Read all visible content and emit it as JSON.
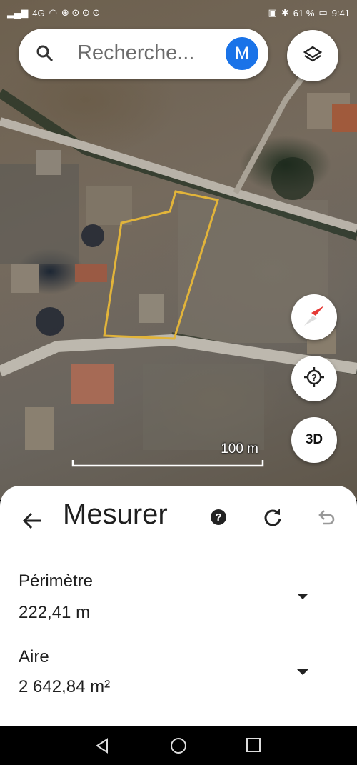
{
  "status_bar": {
    "time": "9:41",
    "battery": "61 %",
    "network": "4G"
  },
  "search": {
    "placeholder": "Recherche...",
    "avatar_initial": "M"
  },
  "map": {
    "scale_label": "100 m",
    "three_d_label": "3D"
  },
  "panel": {
    "title": "Mesurer",
    "metrics": [
      {
        "label": "Périmètre",
        "value": "222,41 m"
      },
      {
        "label": "Aire",
        "value": "2 642,84 m²"
      }
    ]
  },
  "colors": {
    "accent": "#1a73e8",
    "polygon": "#e2b43a",
    "compass_red": "#e53935"
  },
  "icons": [
    "search-icon",
    "layers-icon",
    "compass-icon",
    "my-location-icon",
    "back-arrow-icon",
    "help-icon",
    "redo-icon",
    "undo-icon",
    "chevron-down-icon",
    "nav-back-icon",
    "nav-home-icon",
    "nav-recents-icon"
  ]
}
